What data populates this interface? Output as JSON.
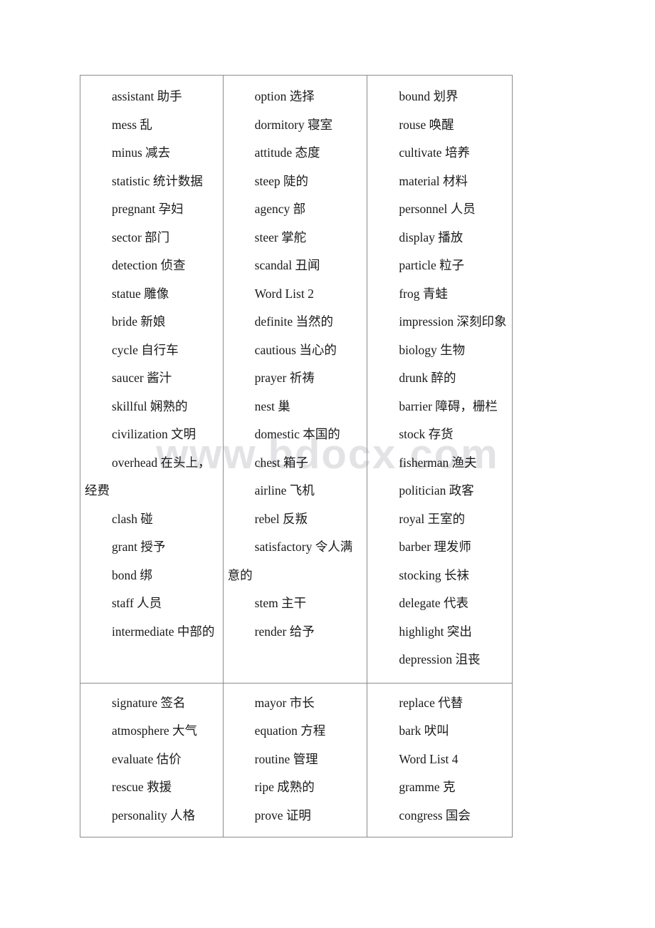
{
  "document": {
    "watermark": "www.bdocx.com",
    "table": {
      "rows": [
        {
          "columns": [
            {
              "entries": [
                "assistant 助手",
                "mess 乱",
                "minus 减去",
                "statistic 统计数据",
                "pregnant 孕妇",
                "sector 部门",
                "detection 侦查",
                "statue 雕像",
                "bride 新娘",
                "cycle 自行车",
                "saucer 酱汁",
                "skillful 娴熟的",
                "civilization 文明",
                "overhead 在头上，经费",
                "clash 碰",
                "grant 授予",
                "bond 绑",
                "staff 人员",
                "intermediate 中部的"
              ]
            },
            {
              "entries": [
                "option 选择",
                "dormitory 寝室",
                "attitude 态度",
                "steep 陡的",
                "agency 部",
                "steer 掌舵",
                "scandal 丑闻",
                "Word List 2",
                "definite 当然的",
                "cautious 当心的",
                "prayer 祈祷",
                "nest 巢",
                "domestic 本国的",
                "chest 箱子",
                "airline 飞机",
                "rebel 反叛",
                "satisfactory 令人满意的",
                "stem 主干",
                "render 给予"
              ]
            },
            {
              "entries": [
                "bound 划界",
                "rouse 唤醒",
                "cultivate 培养",
                "material 材料",
                "personnel 人员",
                "display 播放",
                "particle 粒子",
                "frog 青蛙",
                "impression 深刻印象",
                "biology 生物",
                "drunk 醉的",
                "barrier 障碍，栅栏",
                "stock 存货",
                "fisherman 渔夫",
                "politician 政客",
                "royal 王室的",
                "barber 理发师",
                "stocking 长袜",
                "delegate 代表",
                "highlight 突出",
                "depression 沮丧"
              ]
            }
          ]
        },
        {
          "columns": [
            {
              "entries": [
                "signature 签名",
                "atmosphere 大气",
                "evaluate 估价",
                "rescue 救援",
                "personality 人格"
              ]
            },
            {
              "entries": [
                "mayor 市长",
                "equation 方程",
                "routine 管理",
                "ripe 成熟的",
                "prove 证明"
              ]
            },
            {
              "entries": [
                "replace 代替",
                "bark 吠叫",
                "Word List 4",
                "gramme 克",
                "congress 国会"
              ]
            }
          ]
        }
      ]
    }
  }
}
